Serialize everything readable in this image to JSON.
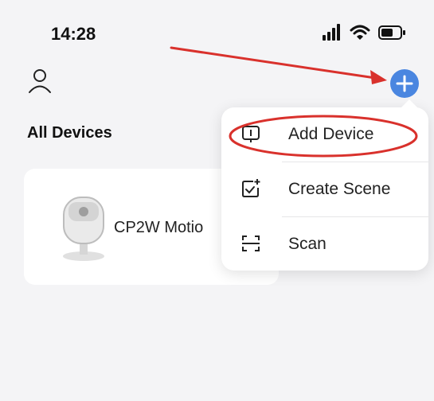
{
  "status_bar": {
    "time": "14:28",
    "icons": [
      "signal-icon",
      "wifi-icon",
      "battery-icon"
    ]
  },
  "header": {
    "profile_icon": "user-icon",
    "add_icon": "plus-icon",
    "accent_color": "#4a86e0"
  },
  "main": {
    "section_title": "All Devices",
    "devices": [
      {
        "name": "CP2W Motio",
        "icon": "camera-device-image"
      }
    ]
  },
  "menu": {
    "items": [
      {
        "label": "Add Device",
        "icon": "add-device-icon"
      },
      {
        "label": "Create Scene",
        "icon": "create-scene-icon"
      },
      {
        "label": "Scan",
        "icon": "scan-icon"
      }
    ]
  },
  "annotation": {
    "color": "#d9312c"
  }
}
